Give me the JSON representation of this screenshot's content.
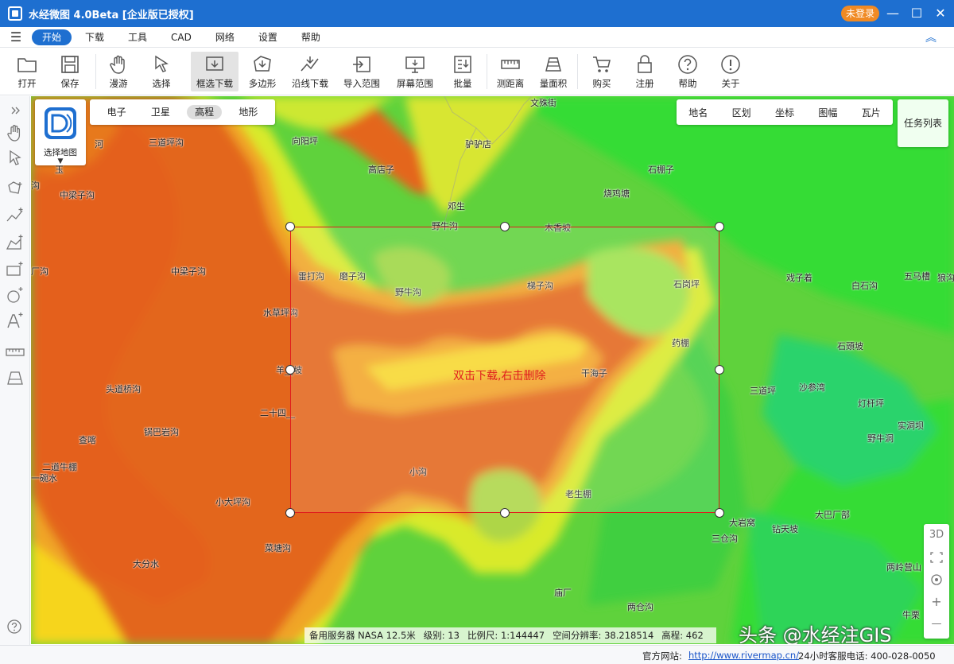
{
  "window": {
    "title": "水经微图 4.0Beta [企业版已授权]",
    "login_label": "未登录"
  },
  "menu": [
    "开始",
    "下载",
    "工具",
    "CAD",
    "网络",
    "设置",
    "帮助"
  ],
  "toolbar": [
    {
      "label": "打开",
      "icon": "folder-icon"
    },
    {
      "label": "保存",
      "icon": "save-icon"
    },
    {
      "label": "漫游",
      "icon": "hand-icon"
    },
    {
      "label": "选择",
      "icon": "cursor-icon"
    },
    {
      "label": "框选下载",
      "icon": "box-download-icon"
    },
    {
      "label": "多边形",
      "icon": "polygon-download-icon"
    },
    {
      "label": "沿线下载",
      "icon": "line-download-icon"
    },
    {
      "label": "导入范围",
      "icon": "import-range-icon"
    },
    {
      "label": "屏幕范围",
      "icon": "screen-range-icon"
    },
    {
      "label": "批量",
      "icon": "batch-icon"
    },
    {
      "label": "测距离",
      "icon": "ruler-icon"
    },
    {
      "label": "量面积",
      "icon": "area-icon"
    },
    {
      "label": "购买",
      "icon": "cart-icon"
    },
    {
      "label": "注册",
      "icon": "lock-icon"
    },
    {
      "label": "帮助",
      "icon": "help-icon"
    },
    {
      "label": "关于",
      "icon": "info-icon"
    }
  ],
  "map_types": [
    "电子",
    "卫星",
    "高程",
    "地形"
  ],
  "active_map_type": "高程",
  "select_map_label": "选择地图",
  "layers": [
    "地名",
    "区划",
    "坐标",
    "图幅",
    "瓦片"
  ],
  "task_list_label": "任务列表",
  "selection_hint": "双击下载,右击删除",
  "zoom_panel": [
    "3D",
    "+",
    "—"
  ],
  "places": [
    "文殊街",
    "向阳坪",
    "三道坪沟",
    "驴驴店",
    "高店子",
    "石棚子",
    "中梁子沟",
    "烧鸡塘",
    "邓生",
    "野牛沟",
    "木香坡",
    "中梁子沟",
    "雷打沟",
    "磨子沟",
    "野牛沟",
    "梯子沟",
    "石岗坪",
    "水草坪沟",
    "羊__坡",
    "药棚",
    "干海子",
    "头道桥沟",
    "二十四__",
    "锅巴岩沟",
    "查喀",
    "二道牛棚",
    "一碗水",
    "小沟",
    "老生棚",
    "小大坪沟",
    "菜塘沟",
    "大分水",
    "庙厂",
    "两仓沟",
    "戏子着",
    "白石沟",
    "五马槽",
    "石頭坡",
    "三道坪",
    "沙参湾",
    "灯杆坪",
    "实洞坝",
    "野牛洞",
    "大巴厂部",
    "大岩窝",
    "钻天坡",
    "三仓沟",
    "两岭营山",
    "牛栗",
    "河",
    "玉",
    "沟",
    "厂沟",
    "狼沟"
  ],
  "status": {
    "server": "备用服务器 NASA 12.5米",
    "level": "级别:  13",
    "scale": "比例尺:  1:144447",
    "resolution": "空间分辨率:  38.218514",
    "elevation": "高程:  462"
  },
  "watermark": "头条 @水经注GIS",
  "footer": {
    "site_label": "官方网站:",
    "site_url": "http://www.rivermap.cn/",
    "hotline": "24小时客服电话:  400-028-0050"
  }
}
